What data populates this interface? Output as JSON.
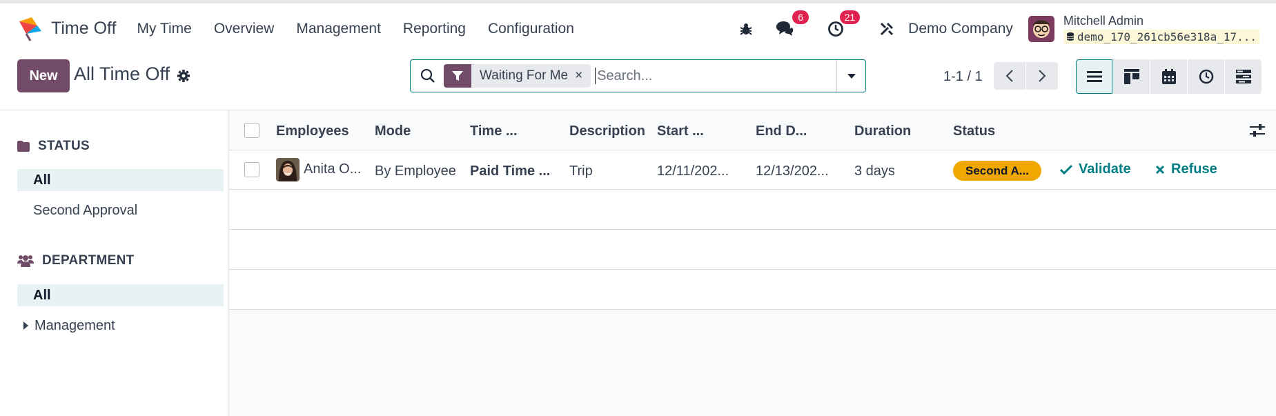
{
  "app": {
    "name": "Time Off"
  },
  "menu": [
    "My Time",
    "Overview",
    "Management",
    "Reporting",
    "Configuration"
  ],
  "systray": {
    "messages_count": "6",
    "activities_count": "21",
    "company": "Demo Company",
    "user_name": "Mitchell Admin",
    "db_name": "demo_170_261cb56e318a_17..."
  },
  "control": {
    "new_label": "New",
    "title": "All Time Off",
    "facet_label": "Waiting For Me",
    "facet_close": "×",
    "search_placeholder": "Search...",
    "pager": "1-1 / 1"
  },
  "sidebar": {
    "status_header": "STATUS",
    "status_items": [
      "All",
      "Second Approval"
    ],
    "department_header": "DEPARTMENT",
    "department_items": [
      "All",
      "Management"
    ]
  },
  "list": {
    "columns": [
      "Employees",
      "Mode",
      "Time ...",
      "Description",
      "Start ...",
      "End D...",
      "Duration",
      "Status"
    ],
    "rows": [
      {
        "employee": "Anita O...",
        "mode": "By Employee",
        "time_off_type": "Paid Time ...",
        "description": "Trip",
        "start": "12/11/202...",
        "end": "12/13/202...",
        "duration": "3 days",
        "status": "Second A...",
        "validate": "Validate",
        "refuse": "Refuse"
      }
    ]
  },
  "colors": {
    "brand": "#714b67",
    "accent": "#017e84",
    "badge": "#e0224e",
    "status_warning": "#f0a800"
  },
  "icons": [
    "bug-icon",
    "chat-icon",
    "clock-icon",
    "tools-icon",
    "database-icon",
    "search-icon",
    "filter-icon",
    "gear-icon",
    "folder-icon",
    "users-icon",
    "list-view-icon",
    "kanban-view-icon",
    "calendar-view-icon",
    "activity-view-icon",
    "gantt-view-icon",
    "settings-sliders-icon",
    "check-icon",
    "x-icon"
  ]
}
